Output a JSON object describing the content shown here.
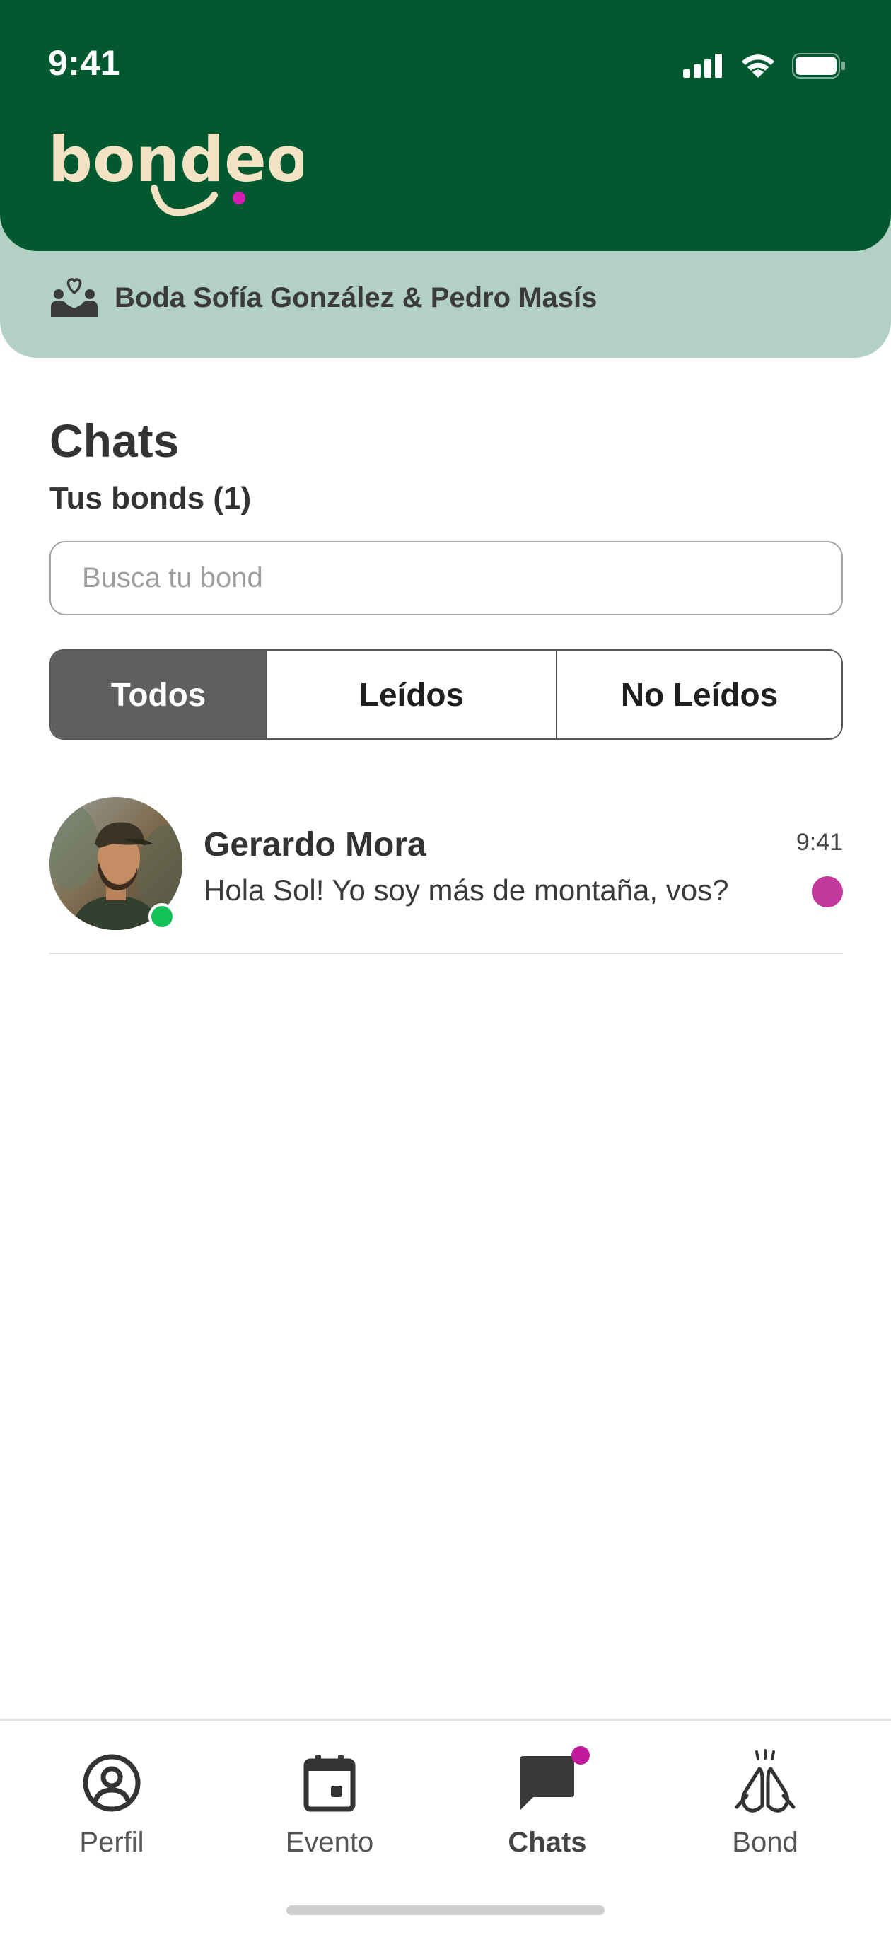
{
  "status_bar": {
    "time": "9:41"
  },
  "header": {
    "logo_text": "bondeo"
  },
  "event": {
    "name": "Boda Sofía González & Pedro Masís"
  },
  "page": {
    "title": "Chats",
    "subtitle": "Tus bonds (1)"
  },
  "search": {
    "placeholder": "Busca tu bond",
    "value": ""
  },
  "filters": {
    "options": [
      "Todos",
      "Leídos",
      "No Leídos"
    ],
    "selected": "Todos"
  },
  "chats": [
    {
      "name": "Gerardo Mora",
      "preview": "Hola Sol! Yo soy más de montaña, vos?",
      "time": "9:41",
      "online": true,
      "unread": true
    }
  ],
  "tabbar": {
    "items": [
      {
        "label": "Perfil",
        "icon": "profile-icon"
      },
      {
        "label": "Evento",
        "icon": "calendar-icon"
      },
      {
        "label": "Chats",
        "icon": "chat-bubble-icon",
        "active": true,
        "badge": true
      },
      {
        "label": "Bond",
        "icon": "clapping-hands-icon"
      }
    ]
  },
  "colors": {
    "primary": "#02592f",
    "banner": "#b2d1c4",
    "accent": "#c2389c",
    "logo": "#f1e3c4",
    "online": "#16c25a"
  }
}
